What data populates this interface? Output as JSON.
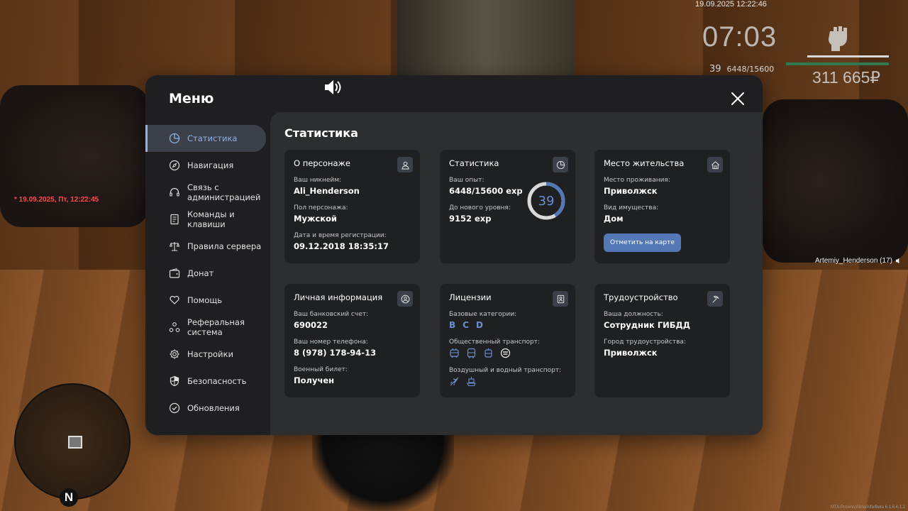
{
  "hud": {
    "date": "19.09.2025 12:22:46",
    "time": "07:03",
    "level": "39",
    "exp": "6448/15600",
    "money": "311 665₽",
    "left_time": "* 19.09.2025, Пт, 12:22:45",
    "player_tag": "Artemiy_Henderson (17)",
    "north": "N",
    "footer": "MTA:Provinc/Alina/Alfa/Beta 6.1.6.4.1.1"
  },
  "menu": {
    "title": "Меню",
    "sidebar": [
      {
        "label": "Статистика",
        "icon": "pie-chart-icon",
        "active": true
      },
      {
        "label": "Навигация",
        "icon": "compass-icon"
      },
      {
        "label": "Связь с администрацией",
        "icon": "headset-icon"
      },
      {
        "label": "Команды и клавиши",
        "icon": "document-icon"
      },
      {
        "label": "Правила сервера",
        "icon": "scales-icon"
      },
      {
        "label": "Донат",
        "icon": "wallet-icon"
      },
      {
        "label": "Помощь",
        "icon": "heart-hand-icon"
      },
      {
        "label": "Реферальная система",
        "icon": "referral-icon"
      },
      {
        "label": "Настройки",
        "icon": "gear-icon"
      },
      {
        "label": "Безопасность",
        "icon": "shield-icon"
      },
      {
        "label": "Обновления",
        "icon": "check-circle-icon"
      }
    ]
  },
  "content": {
    "title": "Статистика",
    "character": {
      "title": "О персонаже",
      "nick_label": "Ваш никнейм:",
      "nick": "Ali_Henderson",
      "gender_label": "Пол персонажа:",
      "gender": "Мужской",
      "reg_label": "Дата и время регистрации:",
      "reg": "09.12.2018 18:35:17"
    },
    "stats": {
      "title": "Статистика",
      "exp_label": "Ваш опыт:",
      "exp": "6448/15600 exp",
      "next_label": "До нового уровня:",
      "next": "9152 exp",
      "level": "39",
      "progress": 0.413
    },
    "residence": {
      "title": "Место жительства",
      "place_label": "Место проживания:",
      "place": "Приволжск",
      "property_label": "Вид имущества:",
      "property": "Дом",
      "map_button": "Отметить на карте"
    },
    "personal": {
      "title": "Личная информация",
      "bank_label": "Ваш банковский счет:",
      "bank": "690022",
      "phone_label": "Ваш номер телефона:",
      "phone": "8 (978) 178-94-13",
      "military_label": "Военный билет:",
      "military": "Получен"
    },
    "licenses": {
      "title": "Лицензии",
      "base_label": "Базовые категории:",
      "categories": [
        "B",
        "C",
        "D"
      ],
      "public_label": "Общественный транспорт:",
      "air_label": "Воздушный и водный транспорт:"
    },
    "employment": {
      "title": "Трудоустройство",
      "position_label": "Ваша должность:",
      "position": "Сотрудник ГИБДД",
      "city_label": "Город трудоустройства:",
      "city": "Приволжск"
    }
  },
  "colors": {
    "accent": "#8fb1e3",
    "button": "#5378b5",
    "panel": "#1f1f21",
    "card": "#1f2022"
  }
}
